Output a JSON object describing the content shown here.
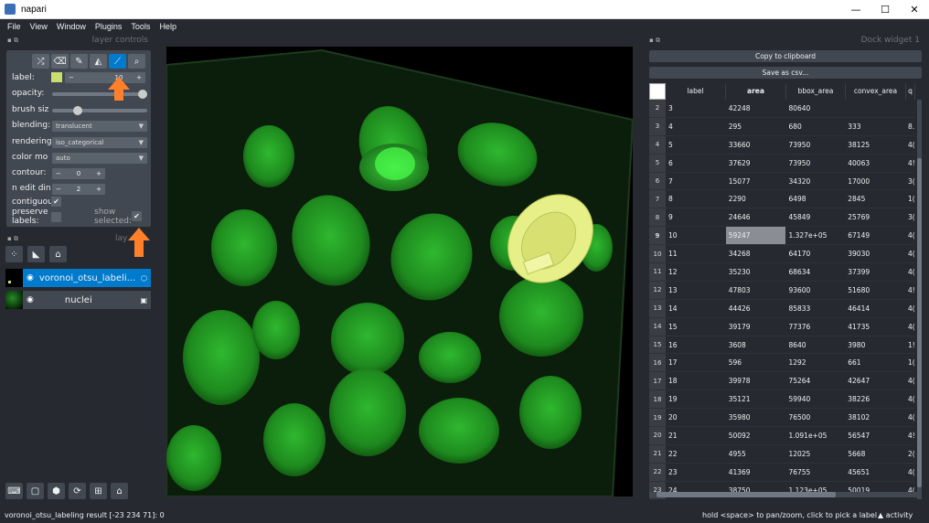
{
  "window": {
    "title": "napari"
  },
  "window_controls": {
    "minimize": "—",
    "maximize": "☐",
    "close": "✕"
  },
  "menu": [
    "File",
    "View",
    "Window",
    "Plugins",
    "Tools",
    "Help"
  ],
  "layer_controls": {
    "header": "layer controls",
    "tools": [
      "shuffle-icon",
      "eraser-icon",
      "paintbrush-icon",
      "fill-icon",
      "picker-icon",
      "zoom-icon"
    ],
    "label_text": "label:",
    "label_value": "10",
    "label_color": "#c8df6f",
    "opacity_text": "opacity:",
    "opacity_value": 1.0,
    "brush_text": "brush siz",
    "brush_value": 0.3,
    "blending_text": "blending:",
    "blending_value": "translucent",
    "rendering_text": "rendering",
    "rendering_value": "iso_categorical",
    "color_mode_text": "color mo",
    "color_mode_value": "auto",
    "contour_text": "contour:",
    "contour_value": "0",
    "n_edit_text": "n edit din",
    "n_edit_value": "2",
    "contiguous_text": "contiguou",
    "preserve_text_1": "preserve",
    "preserve_text_2": "labels:",
    "show_selected_text_1": "show",
    "show_selected_text_2": "selected:",
    "spin_minus": "−",
    "spin_plus": "+",
    "check_mark": "✔"
  },
  "layer_list": {
    "header": "lay",
    "layers": [
      {
        "name": "voronoi_otsu_labeli...",
        "selected": true,
        "type_icon": "labels-icon"
      },
      {
        "name": "nuclei",
        "selected": false,
        "type_icon": "image-icon"
      }
    ]
  },
  "dock": {
    "header": "Dock widget 1",
    "copy_button": "Copy to clipboard",
    "save_button": "Save as csv...",
    "columns": [
      "label",
      "area",
      "bbox_area",
      "convex_area",
      "q"
    ],
    "rows": [
      [
        "2",
        "3",
        "42248",
        "80640",
        "",
        ""
      ],
      [
        "3",
        "4",
        "295",
        "680",
        "333",
        "8."
      ],
      [
        "4",
        "5",
        "33660",
        "73950",
        "38125",
        "4("
      ],
      [
        "5",
        "6",
        "37629",
        "73950",
        "40063",
        "4!"
      ],
      [
        "6",
        "7",
        "15077",
        "34320",
        "17000",
        "3("
      ],
      [
        "7",
        "8",
        "2290",
        "6498",
        "2845",
        "1("
      ],
      [
        "8",
        "9",
        "24646",
        "45849",
        "25769",
        "3("
      ],
      [
        "9",
        "10",
        "59247",
        "1.327e+05",
        "67149",
        "4("
      ],
      [
        "10",
        "11",
        "34268",
        "64170",
        "39030",
        "4("
      ],
      [
        "11",
        "12",
        "35230",
        "68634",
        "37399",
        "4("
      ],
      [
        "12",
        "13",
        "47803",
        "93600",
        "51680",
        "4!"
      ],
      [
        "13",
        "14",
        "44426",
        "85833",
        "46414",
        "4("
      ],
      [
        "14",
        "15",
        "39179",
        "77376",
        "41735",
        "4("
      ],
      [
        "15",
        "16",
        "3608",
        "8640",
        "3980",
        "1!"
      ],
      [
        "16",
        "17",
        "596",
        "1292",
        "661",
        "1("
      ],
      [
        "17",
        "18",
        "39978",
        "75264",
        "42647",
        "4("
      ],
      [
        "18",
        "19",
        "35121",
        "59940",
        "38226",
        "4("
      ],
      [
        "19",
        "20",
        "35980",
        "76500",
        "38102",
        "4("
      ],
      [
        "20",
        "21",
        "50092",
        "1.091e+05",
        "56547",
        "4!"
      ],
      [
        "21",
        "22",
        "4955",
        "12025",
        "5668",
        "2("
      ],
      [
        "22",
        "23",
        "41369",
        "76755",
        "45651",
        "4("
      ],
      [
        "23",
        "24",
        "38750",
        "1.123e+05",
        "50019",
        "4("
      ]
    ],
    "selected_row": "9"
  },
  "status": {
    "left": "voronoi_otsu_labeling result [-23 234  71]: 0",
    "middle": "hold <space> to pan/zoom, click to pick a label",
    "right": "▲ activity"
  },
  "colors": {
    "bg": "#262930",
    "panel": "#414851",
    "accent": "#007acc",
    "arrow": "#ff7f2a",
    "nuclei": "#2fb82f"
  }
}
